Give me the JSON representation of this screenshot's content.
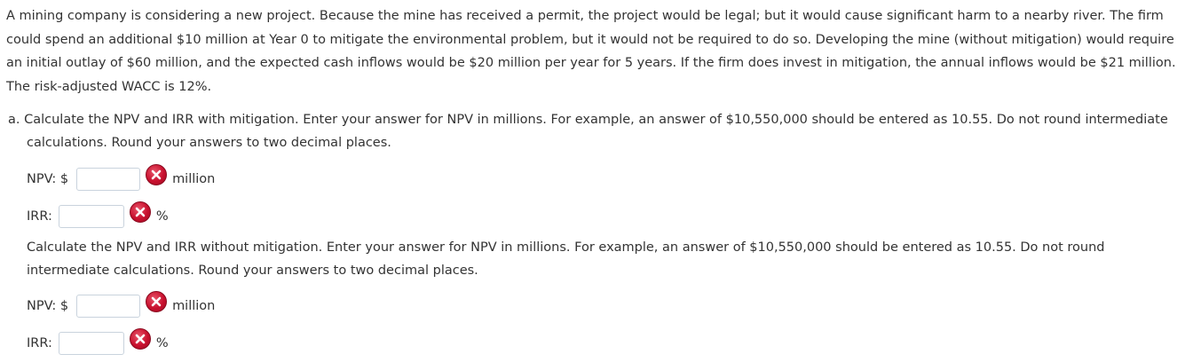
{
  "intro": "A mining company is considering a new project. Because the mine has received a permit, the project would be legal; but it would cause significant harm to a nearby river. The firm could spend an additional $10 million at Year 0 to mitigate the environmental problem, but it would not be required to do so. Developing the mine (without mitigation) would require an initial outlay of $60 million, and the expected cash inflows would be $20 million per year for 5 years. If the firm does invest in mitigation, the annual inflows would be $21 million. The risk-adjusted WACC is 12%.",
  "part_a": {
    "label": "a.",
    "question": "Calculate the NPV and IRR with mitigation. Enter your answer for NPV in millions. For example, an answer of $10,550,000 should be entered as 10.55. Do not round intermediate calculations. Round your answers to two decimal places.",
    "npv_label": "NPV: $",
    "npv_value": "",
    "npv_unit": "million",
    "irr_label": "IRR:",
    "irr_value": "",
    "irr_unit": "%"
  },
  "part_b": {
    "question": "Calculate the NPV and IRR without mitigation. Enter your answer for NPV in millions. For example, an answer of $10,550,000 should be entered as 10.55. Do not round intermediate calculations. Round your answers to two decimal places.",
    "npv_label": "NPV: $",
    "npv_value": "",
    "npv_unit": "million",
    "irr_label": "IRR:",
    "irr_value": "",
    "irr_unit": "%"
  },
  "icons": {
    "incorrect": "incorrect-x-icon"
  },
  "colors": {
    "text": "#333333",
    "error_red": "#c8102e",
    "input_border": "#c9d3dd"
  }
}
